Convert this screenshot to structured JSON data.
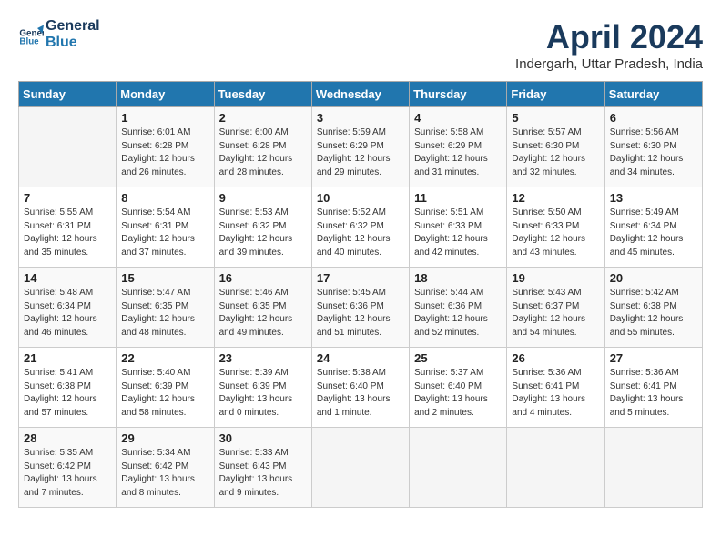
{
  "logo": {
    "line1": "General",
    "line2": "Blue"
  },
  "title": "April 2024",
  "subtitle": "Indergarh, Uttar Pradesh, India",
  "headers": [
    "Sunday",
    "Monday",
    "Tuesday",
    "Wednesday",
    "Thursday",
    "Friday",
    "Saturday"
  ],
  "weeks": [
    [
      {
        "day": "",
        "info": ""
      },
      {
        "day": "1",
        "info": "Sunrise: 6:01 AM\nSunset: 6:28 PM\nDaylight: 12 hours\nand 26 minutes."
      },
      {
        "day": "2",
        "info": "Sunrise: 6:00 AM\nSunset: 6:28 PM\nDaylight: 12 hours\nand 28 minutes."
      },
      {
        "day": "3",
        "info": "Sunrise: 5:59 AM\nSunset: 6:29 PM\nDaylight: 12 hours\nand 29 minutes."
      },
      {
        "day": "4",
        "info": "Sunrise: 5:58 AM\nSunset: 6:29 PM\nDaylight: 12 hours\nand 31 minutes."
      },
      {
        "day": "5",
        "info": "Sunrise: 5:57 AM\nSunset: 6:30 PM\nDaylight: 12 hours\nand 32 minutes."
      },
      {
        "day": "6",
        "info": "Sunrise: 5:56 AM\nSunset: 6:30 PM\nDaylight: 12 hours\nand 34 minutes."
      }
    ],
    [
      {
        "day": "7",
        "info": "Sunrise: 5:55 AM\nSunset: 6:31 PM\nDaylight: 12 hours\nand 35 minutes."
      },
      {
        "day": "8",
        "info": "Sunrise: 5:54 AM\nSunset: 6:31 PM\nDaylight: 12 hours\nand 37 minutes."
      },
      {
        "day": "9",
        "info": "Sunrise: 5:53 AM\nSunset: 6:32 PM\nDaylight: 12 hours\nand 39 minutes."
      },
      {
        "day": "10",
        "info": "Sunrise: 5:52 AM\nSunset: 6:32 PM\nDaylight: 12 hours\nand 40 minutes."
      },
      {
        "day": "11",
        "info": "Sunrise: 5:51 AM\nSunset: 6:33 PM\nDaylight: 12 hours\nand 42 minutes."
      },
      {
        "day": "12",
        "info": "Sunrise: 5:50 AM\nSunset: 6:33 PM\nDaylight: 12 hours\nand 43 minutes."
      },
      {
        "day": "13",
        "info": "Sunrise: 5:49 AM\nSunset: 6:34 PM\nDaylight: 12 hours\nand 45 minutes."
      }
    ],
    [
      {
        "day": "14",
        "info": "Sunrise: 5:48 AM\nSunset: 6:34 PM\nDaylight: 12 hours\nand 46 minutes."
      },
      {
        "day": "15",
        "info": "Sunrise: 5:47 AM\nSunset: 6:35 PM\nDaylight: 12 hours\nand 48 minutes."
      },
      {
        "day": "16",
        "info": "Sunrise: 5:46 AM\nSunset: 6:35 PM\nDaylight: 12 hours\nand 49 minutes."
      },
      {
        "day": "17",
        "info": "Sunrise: 5:45 AM\nSunset: 6:36 PM\nDaylight: 12 hours\nand 51 minutes."
      },
      {
        "day": "18",
        "info": "Sunrise: 5:44 AM\nSunset: 6:36 PM\nDaylight: 12 hours\nand 52 minutes."
      },
      {
        "day": "19",
        "info": "Sunrise: 5:43 AM\nSunset: 6:37 PM\nDaylight: 12 hours\nand 54 minutes."
      },
      {
        "day": "20",
        "info": "Sunrise: 5:42 AM\nSunset: 6:38 PM\nDaylight: 12 hours\nand 55 minutes."
      }
    ],
    [
      {
        "day": "21",
        "info": "Sunrise: 5:41 AM\nSunset: 6:38 PM\nDaylight: 12 hours\nand 57 minutes."
      },
      {
        "day": "22",
        "info": "Sunrise: 5:40 AM\nSunset: 6:39 PM\nDaylight: 12 hours\nand 58 minutes."
      },
      {
        "day": "23",
        "info": "Sunrise: 5:39 AM\nSunset: 6:39 PM\nDaylight: 13 hours\nand 0 minutes."
      },
      {
        "day": "24",
        "info": "Sunrise: 5:38 AM\nSunset: 6:40 PM\nDaylight: 13 hours\nand 1 minute."
      },
      {
        "day": "25",
        "info": "Sunrise: 5:37 AM\nSunset: 6:40 PM\nDaylight: 13 hours\nand 2 minutes."
      },
      {
        "day": "26",
        "info": "Sunrise: 5:36 AM\nSunset: 6:41 PM\nDaylight: 13 hours\nand 4 minutes."
      },
      {
        "day": "27",
        "info": "Sunrise: 5:36 AM\nSunset: 6:41 PM\nDaylight: 13 hours\nand 5 minutes."
      }
    ],
    [
      {
        "day": "28",
        "info": "Sunrise: 5:35 AM\nSunset: 6:42 PM\nDaylight: 13 hours\nand 7 minutes."
      },
      {
        "day": "29",
        "info": "Sunrise: 5:34 AM\nSunset: 6:42 PM\nDaylight: 13 hours\nand 8 minutes."
      },
      {
        "day": "30",
        "info": "Sunrise: 5:33 AM\nSunset: 6:43 PM\nDaylight: 13 hours\nand 9 minutes."
      },
      {
        "day": "",
        "info": ""
      },
      {
        "day": "",
        "info": ""
      },
      {
        "day": "",
        "info": ""
      },
      {
        "day": "",
        "info": ""
      }
    ]
  ]
}
